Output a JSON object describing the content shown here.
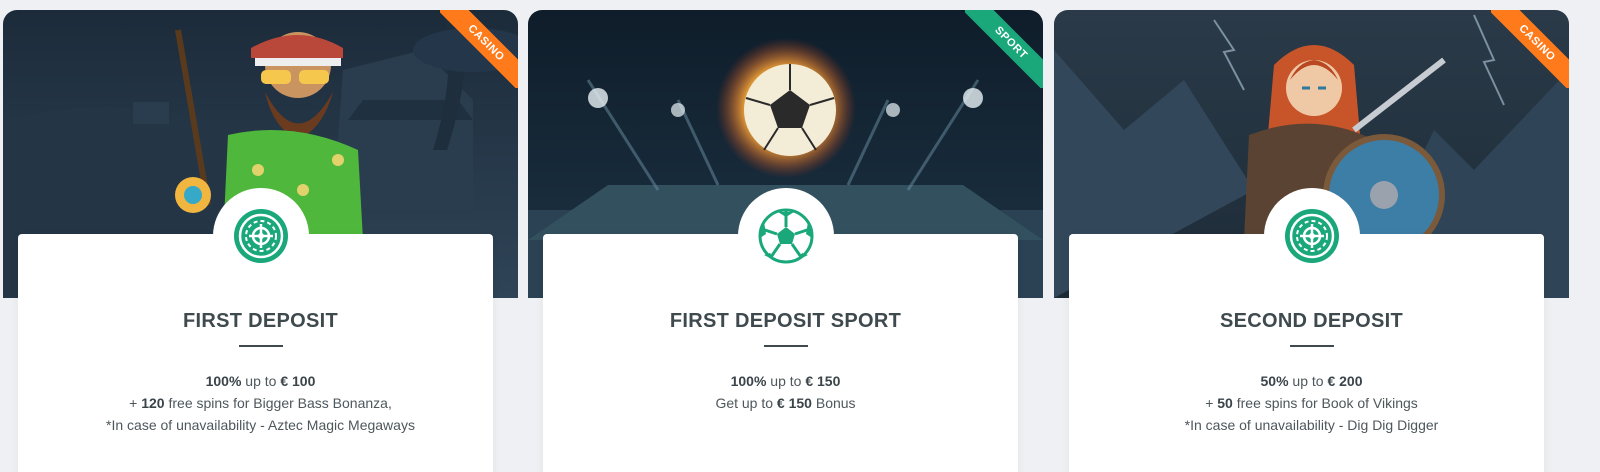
{
  "colors": {
    "casino_tag": "#ff7a1a",
    "sport_tag": "#1aa87a",
    "icon_green": "#1aa87a",
    "title_text": "#3f4a4f"
  },
  "cards": [
    {
      "tag": "CASINO",
      "icon": "roulette-icon",
      "title": "FIRST DEPOSIT",
      "line1": {
        "pct": "100%",
        "mid": " up to ",
        "amount": "€ 100"
      },
      "line2": {
        "pre": "+ ",
        "bold": "120",
        "post": " free spins for Bigger Bass Bonanza,"
      },
      "line3": {
        "text": "*In case of unavailability - Aztec Magic Megaways"
      }
    },
    {
      "tag": "SPORT",
      "icon": "soccer-ball-icon",
      "title": "FIRST DEPOSIT SPORT",
      "line1": {
        "pct": "100%",
        "mid": " up to ",
        "amount": "€ 150"
      },
      "line2": {
        "pre": "Get up to ",
        "bold": "€ 150",
        "post": " Bonus"
      }
    },
    {
      "tag": "CASINO",
      "icon": "roulette-icon",
      "title": "SECOND DEPOSIT",
      "line1": {
        "pct": "50%",
        "mid": " up to ",
        "amount": "€ 200"
      },
      "line2": {
        "pre": "+ ",
        "bold": "50",
        "post": " free spins for Book of Vikings"
      },
      "line3": {
        "text": "*In case of unavailability - Dig Dig Digger"
      }
    }
  ]
}
